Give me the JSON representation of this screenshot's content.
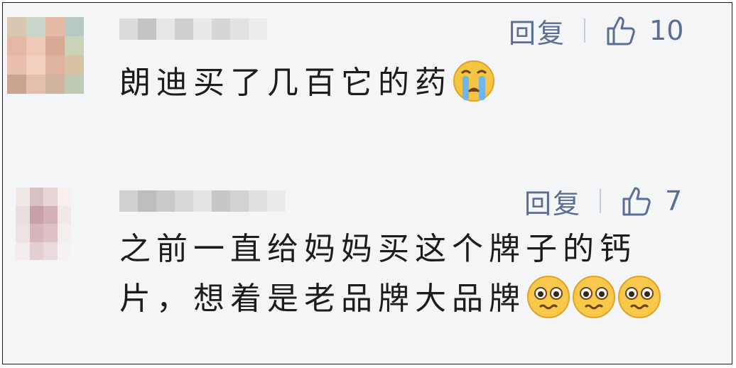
{
  "comments": [
    {
      "reply_label": "回复",
      "like_count": "10",
      "text": "朗迪买了几百它的药",
      "emojis": [
        "crying-face-icon"
      ]
    },
    {
      "reply_label": "回复",
      "like_count": "7",
      "text_line1": "之前一直给妈妈买这个牌子的钙",
      "text_line2": "片，想着是老品牌大品牌",
      "emojis": [
        "pleading-face-icon",
        "pleading-face-icon",
        "pleading-face-icon"
      ]
    }
  ],
  "colors": {
    "background": "#f4f5f7",
    "action_text": "#5b6e92",
    "comment_text": "#1c1c1c"
  }
}
